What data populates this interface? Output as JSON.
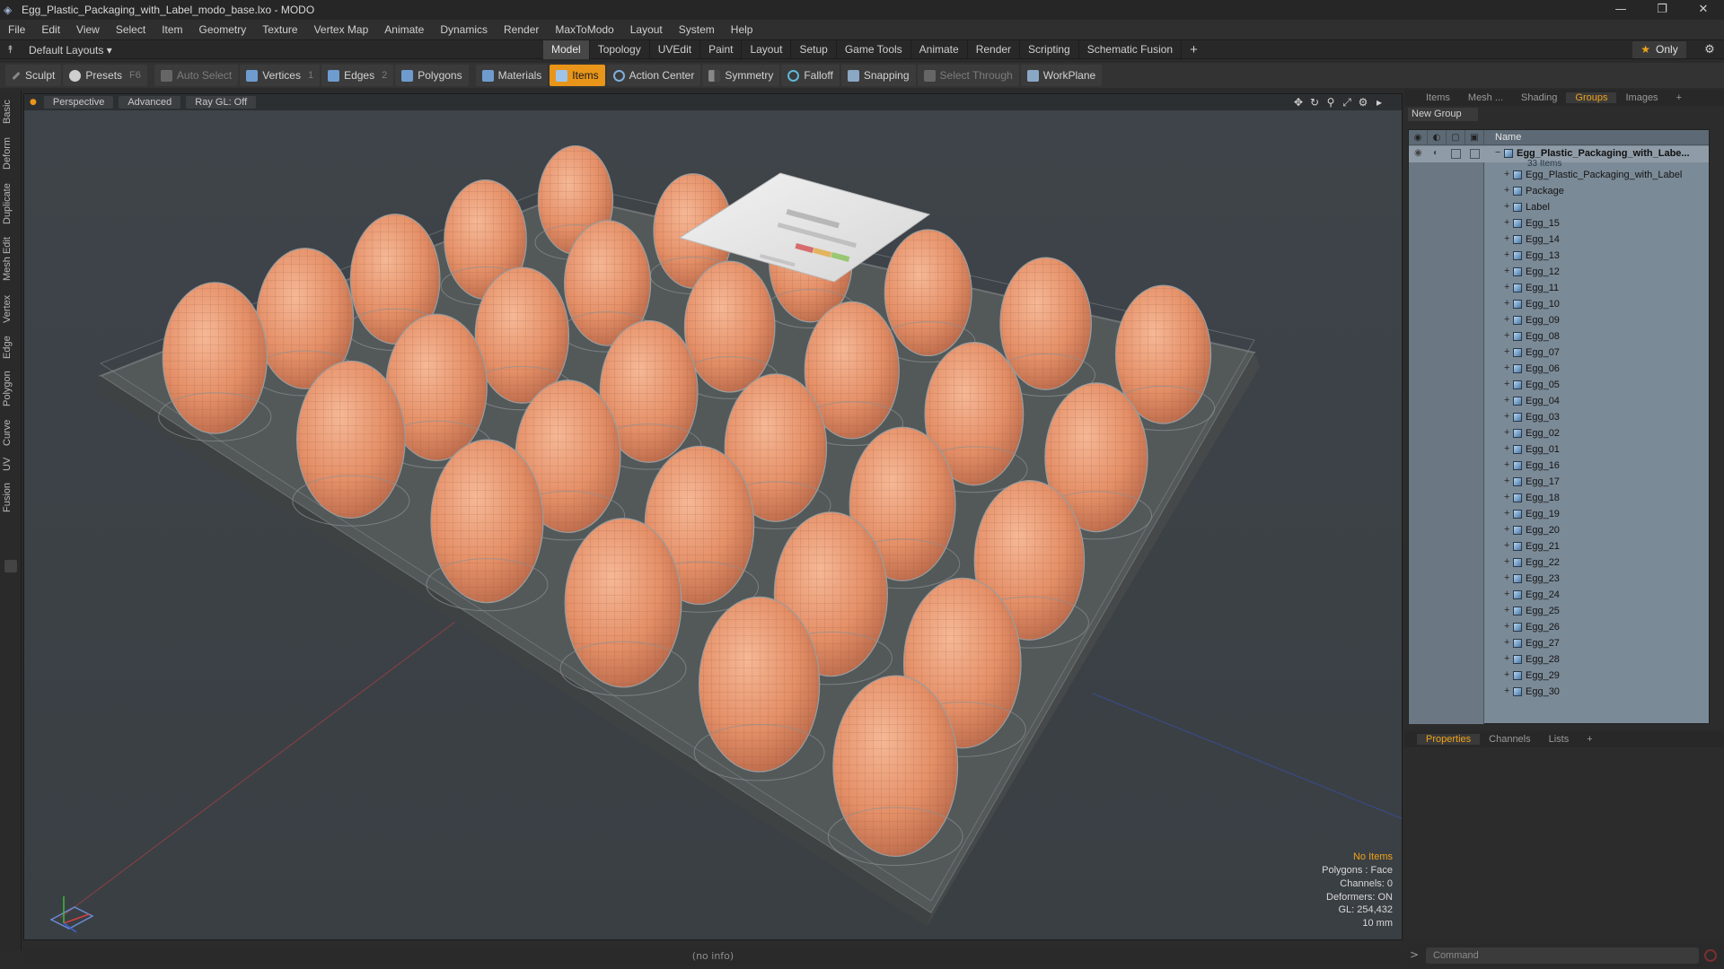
{
  "window": {
    "title": "Egg_Plastic_Packaging_with_Label_modo_base.lxo - MODO",
    "controls": {
      "minimize": "—",
      "restore": "❐",
      "close": "✕"
    }
  },
  "menu": [
    "File",
    "Edit",
    "View",
    "Select",
    "Item",
    "Geometry",
    "Texture",
    "Vertex Map",
    "Animate",
    "Dynamics",
    "Render",
    "MaxToModo",
    "Layout",
    "System",
    "Help"
  ],
  "layout": {
    "selector": "Default Layouts ▾",
    "tabs": [
      "Model",
      "Topology",
      "UVEdit",
      "Paint",
      "Layout",
      "Setup",
      "Game Tools",
      "Animate",
      "Render",
      "Scripting",
      "Schematic Fusion"
    ],
    "active_tab": "Model",
    "add": "+",
    "only_label": "Only"
  },
  "toolbar": {
    "sculpt": "Sculpt",
    "presets": "Presets",
    "presets_key": "F6",
    "auto_select": "Auto Select",
    "vertices": "Vertices",
    "vertices_key": "1",
    "edges": "Edges",
    "edges_key": "2",
    "polygons": "Polygons",
    "materials": "Materials",
    "items": "Items",
    "action_center": "Action Center",
    "symmetry": "Symmetry",
    "falloff": "Falloff",
    "snapping": "Snapping",
    "select_through": "Select Through",
    "workplane": "WorkPlane"
  },
  "left_tabs": [
    "Basic",
    "Deform",
    "Duplicate",
    "Mesh Edit",
    "Vertex",
    "Edge",
    "Polygon",
    "Curve",
    "UV",
    "Fusion"
  ],
  "viewport": {
    "view": "Perspective",
    "mode": "Advanced",
    "ray": "Ray GL: Off",
    "info": {
      "items": "No Items",
      "polygons": "Polygons : Face",
      "channels": "Channels: 0",
      "deformers": "Deformers: ON",
      "gl": "GL: 254,432",
      "scale": "10 mm"
    }
  },
  "status": "(no info)",
  "right_panel": {
    "tabs": [
      "Items",
      "Mesh ...",
      "Shading",
      "Groups",
      "Images"
    ],
    "active_tab": "Groups",
    "add": "+",
    "new_group": "New Group",
    "name_header": "Name",
    "group_name": "Egg_Plastic_Packaging_with_Labe...",
    "group_count": "33 Items",
    "items": [
      "Egg_Plastic_Packaging_with_Label",
      "Package",
      "Label",
      "Egg_15",
      "Egg_14",
      "Egg_13",
      "Egg_12",
      "Egg_11",
      "Egg_10",
      "Egg_09",
      "Egg_08",
      "Egg_07",
      "Egg_06",
      "Egg_05",
      "Egg_04",
      "Egg_03",
      "Egg_02",
      "Egg_01",
      "Egg_16",
      "Egg_17",
      "Egg_18",
      "Egg_19",
      "Egg_20",
      "Egg_21",
      "Egg_22",
      "Egg_23",
      "Egg_24",
      "Egg_25",
      "Egg_26",
      "Egg_27",
      "Egg_28",
      "Egg_29",
      "Egg_30"
    ]
  },
  "properties": {
    "tabs": [
      "Properties",
      "Channels",
      "Lists"
    ],
    "active_tab": "Properties",
    "add": "+"
  },
  "command": {
    "prompt": ">",
    "placeholder": "Command"
  },
  "colors": {
    "accent": "#e8951a",
    "egg": "#e79a73",
    "tree_bg": "#7b8a97"
  }
}
